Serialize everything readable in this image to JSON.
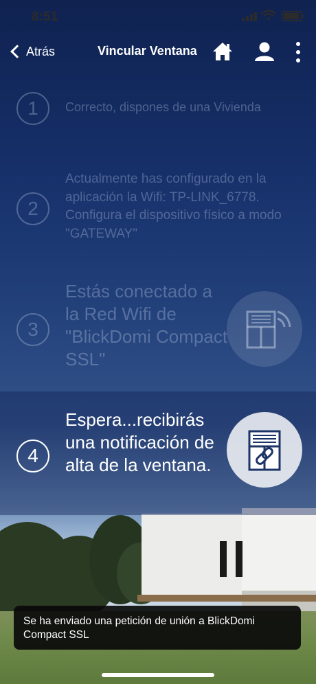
{
  "status_bar": {
    "time": "8:51",
    "battery_level": 0.9
  },
  "nav": {
    "back_label": "Atrás",
    "title": "Vincular Ventana",
    "icons": [
      "home-icon",
      "user-icon",
      "more-vertical-icon"
    ]
  },
  "steps": [
    {
      "number": "1",
      "text": "Correcto, dispones de una Vivienda"
    },
    {
      "number": "2",
      "text": "Actualmente has configurado en la aplicación la Wifi: TP-LINK_6778. Configura el dispositivo físico a modo \"GATEWAY\""
    },
    {
      "number": "3",
      "text": "Estás conectado a la Red Wifi de \"BlickDomi Compact SSL\"",
      "icon": "window-wifi-icon"
    },
    {
      "number": "4",
      "text": "Espera...recibirás una notificación de alta de la ventana.",
      "icon": "window-link-icon"
    }
  ],
  "toast": {
    "message": "Se ha enviado una petición de unión a BlickDomi Compact SSL"
  }
}
